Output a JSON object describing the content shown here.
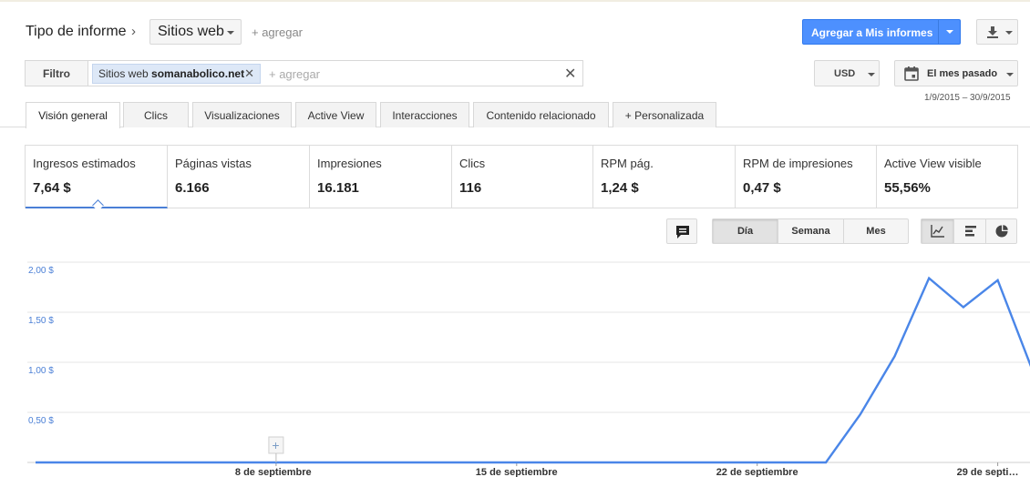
{
  "header": {
    "report_type_label": "Tipo de informe",
    "chevron": "›",
    "report_dimension": "Sitios web",
    "add_label": "+ agregar",
    "add_to_reports_label": "Agregar a Mis informes"
  },
  "filter": {
    "button_label": "Filtro",
    "chip_prefix": "Sitios web",
    "chip_value": "somanabolico.net",
    "chip_remove": "✕",
    "add_placeholder": "+ agregar",
    "clear": "✕"
  },
  "currency": {
    "value": "USD"
  },
  "date_range": {
    "label": "El mes pasado",
    "dates": "1/9/2015 – 30/9/2015"
  },
  "tabs": [
    {
      "label": "Visión general",
      "active": true
    },
    {
      "label": "Clics"
    },
    {
      "label": "Visualizaciones"
    },
    {
      "label": "Active View"
    },
    {
      "label": "Interacciones"
    },
    {
      "label": "Contenido relacionado"
    },
    {
      "label": "+  Personalizada"
    }
  ],
  "metrics": [
    {
      "label": "Ingresos estimados",
      "value": "7,64 $",
      "active": true
    },
    {
      "label": "Páginas vistas",
      "value": "6.166"
    },
    {
      "label": "Impresiones",
      "value": "16.181"
    },
    {
      "label": "Clics",
      "value": "116"
    },
    {
      "label": "RPM pág.",
      "value": "1,24 $"
    },
    {
      "label": "RPM de impresiones",
      "value": "0,47 $"
    },
    {
      "label": "Active View visible",
      "value": "55,56%"
    }
  ],
  "chart_controls": {
    "periods": [
      "Día",
      "Semana",
      "Mes"
    ],
    "active_period": "Día",
    "views": [
      "line-chart-icon",
      "bar-chart-icon",
      "pie-chart-icon"
    ],
    "active_view": "line-chart-icon"
  },
  "colors": {
    "accent": "#4d90fe",
    "series": "#4a86e8",
    "axis_label": "#4a7fd6"
  },
  "chart_data": {
    "type": "line",
    "x": [
      "1/9",
      "2/9",
      "3/9",
      "4/9",
      "5/9",
      "6/9",
      "7/9",
      "8/9",
      "9/9",
      "10/9",
      "11/9",
      "12/9",
      "13/9",
      "14/9",
      "15/9",
      "16/9",
      "17/9",
      "18/9",
      "19/9",
      "20/9",
      "21/9",
      "22/9",
      "23/9",
      "24/9",
      "25/9",
      "26/9",
      "27/9",
      "28/9",
      "29/9",
      "30/9"
    ],
    "series": [
      {
        "values": [
          0,
          0,
          0,
          0,
          0,
          0,
          0,
          0,
          0,
          0,
          0,
          0,
          0,
          0,
          0,
          0,
          0,
          0,
          0,
          0,
          0,
          0,
          0,
          0,
          0.48,
          1.06,
          1.84,
          1.55,
          1.82,
          0.93
        ]
      }
    ],
    "yticks": [
      "2,00 $",
      "1,50 $",
      "1,00 $",
      "0,50 $"
    ],
    "ytick_values": [
      2.0,
      1.5,
      1.0,
      0.5
    ],
    "xticks": [
      "8 de septiembre",
      "15 de septiembre",
      "22 de septiembre",
      "29 de septi…"
    ],
    "xtick_indices": [
      7,
      14,
      21,
      28
    ],
    "ylim": [
      0,
      2.0
    ],
    "grid": true,
    "annotation_marker": {
      "label": "+",
      "x_index": 7
    }
  }
}
